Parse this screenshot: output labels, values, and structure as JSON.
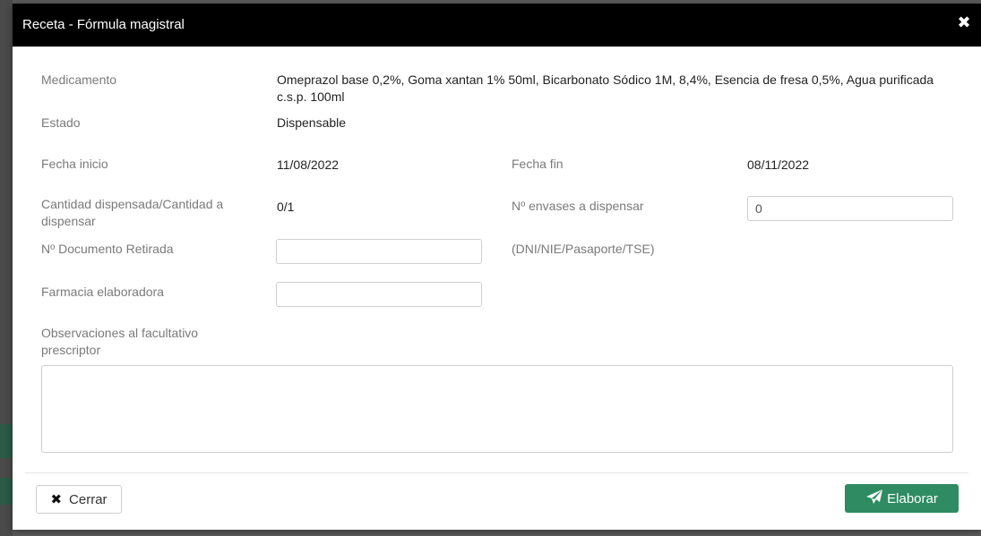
{
  "modal": {
    "title": "Receta - Fórmula magistral",
    "close_icon": "close-icon"
  },
  "fields": {
    "medicamento": {
      "label": "Medicamento",
      "value": "Omeprazol base 0,2%, Goma xantan 1% 50ml, Bicarbonato Sódico 1M, 8,4%, Esencia de fresa 0,5%, Agua purificada c.s.p. 100ml"
    },
    "estado": {
      "label": "Estado",
      "value": "Dispensable"
    },
    "fecha_inicio": {
      "label": "Fecha inicio",
      "value": "11/08/2022"
    },
    "fecha_fin": {
      "label": "Fecha fin",
      "value": "08/11/2022"
    },
    "cantidad": {
      "label": "Cantidad dispensada/Cantidad a dispensar",
      "value": "0/1"
    },
    "envases": {
      "label": "Nº envases a dispensar",
      "value": "0"
    },
    "documento": {
      "label": "Nº Documento Retirada",
      "value": "",
      "hint": "(DNI/NIE/Pasaporte/TSE)"
    },
    "farmacia": {
      "label": "Farmacia elaboradora",
      "value": ""
    },
    "observaciones": {
      "label": "Observaciones al facultativo prescriptor",
      "value": ""
    }
  },
  "footer": {
    "close_label": "Cerrar",
    "close_icon": "close-icon",
    "submit_label": "Elaborar",
    "submit_icon": "paper-plane-icon",
    "submit_color": "#2e8b62"
  },
  "colors": {
    "header_bg": "#000000",
    "label": "#7a7a7a",
    "value": "#222222"
  }
}
